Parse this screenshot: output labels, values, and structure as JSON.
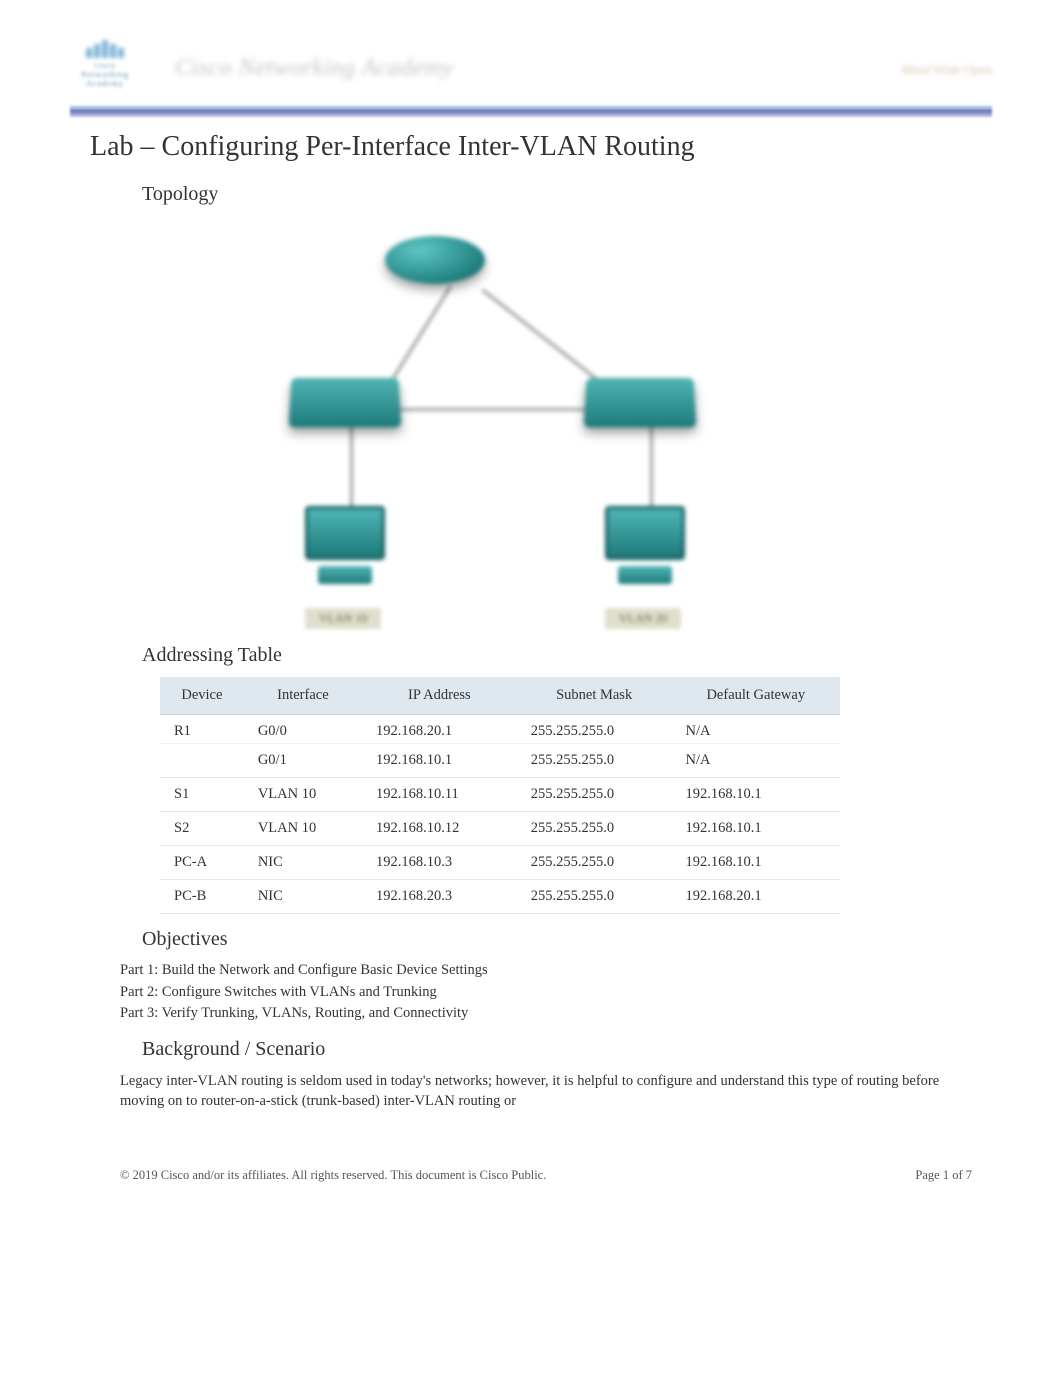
{
  "header": {
    "brand_top": "cisco",
    "brand_bottom": "Networking Academy",
    "center": "Cisco Networking Academy",
    "right": "Mind Wide Open"
  },
  "title": "Lab – Configuring Per-Interface Inter-VLAN Routing",
  "sections": {
    "topology": "Topology",
    "addressing": "Addressing Table",
    "objectives": "Objectives",
    "background": "Background / Scenario"
  },
  "topology": {
    "vlan_left": "VLAN 10",
    "vlan_right": "VLAN 20"
  },
  "addressing_table": {
    "headers": [
      "Device",
      "Interface",
      "IP Address",
      "Subnet Mask",
      "Default Gateway"
    ],
    "rows": [
      [
        "R1",
        "G0/0",
        "192.168.20.1",
        "255.255.255.0",
        "N/A"
      ],
      [
        "",
        "G0/1",
        "192.168.10.1",
        "255.255.255.0",
        "N/A"
      ],
      [
        "S1",
        "VLAN 10",
        "192.168.10.11",
        "255.255.255.0",
        "192.168.10.1"
      ],
      [
        "S2",
        "VLAN 10",
        "192.168.10.12",
        "255.255.255.0",
        "192.168.10.1"
      ],
      [
        "PC-A",
        "NIC",
        "192.168.10.3",
        "255.255.255.0",
        "192.168.10.1"
      ],
      [
        "PC-B",
        "NIC",
        "192.168.20.3",
        "255.255.255.0",
        "192.168.20.1"
      ]
    ]
  },
  "objectives": {
    "part1": "Part 1: Build the Network and Configure Basic Device Settings",
    "part2": "Part 2: Configure Switches with VLANs and Trunking",
    "part3": "Part 3: Verify Trunking, VLANs, Routing, and Connectivity"
  },
  "background_text": "Legacy inter-VLAN routing is seldom used in today's networks; however, it is helpful to configure and understand this type of routing before moving on to router-on-a-stick (trunk-based) inter-VLAN routing or",
  "footer": {
    "left": "© 2019 Cisco and/or its affiliates. All rights reserved. This document is Cisco Public.",
    "right": "Page  1 of 7"
  }
}
